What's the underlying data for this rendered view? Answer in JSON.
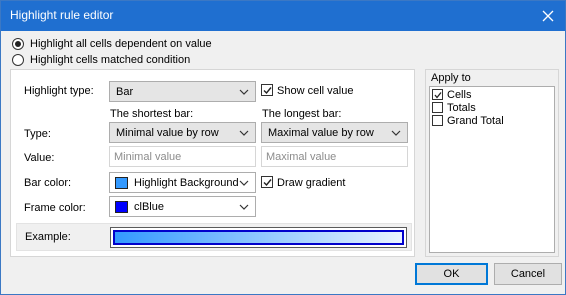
{
  "window": {
    "title": "Highlight rule editor"
  },
  "mode": {
    "option_all": "Highlight all cells dependent on value",
    "option_condition": "Highlight cells matched condition",
    "selected": "all"
  },
  "highlight": {
    "type_label": "Highlight type:",
    "type_value": "Bar",
    "show_cell_value_label": "Show cell value",
    "show_cell_value_checked": true
  },
  "bars": {
    "shortest_header": "The shortest bar:",
    "longest_header": "The longest bar:",
    "type_label": "Type:",
    "shortest_type": "Minimal value by row",
    "longest_type": "Maximal value by row",
    "value_label": "Value:",
    "shortest_value_placeholder": "Minimal value",
    "longest_value_placeholder": "Maximal value"
  },
  "colors": {
    "bar_color_label": "Bar color:",
    "bar_color_name": "Highlight Background",
    "bar_color_hex": "#3399ff",
    "draw_gradient_label": "Draw gradient",
    "draw_gradient_checked": true,
    "frame_color_label": "Frame color:",
    "frame_color_name": "clBlue",
    "frame_color_hex": "#0000ff"
  },
  "example": {
    "label": "Example:"
  },
  "apply_to": {
    "title": "Apply to",
    "items": [
      {
        "label": "Cells",
        "checked": true
      },
      {
        "label": "Totals",
        "checked": false
      },
      {
        "label": "Grand Total",
        "checked": false
      }
    ]
  },
  "buttons": {
    "ok": "OK",
    "cancel": "Cancel"
  }
}
